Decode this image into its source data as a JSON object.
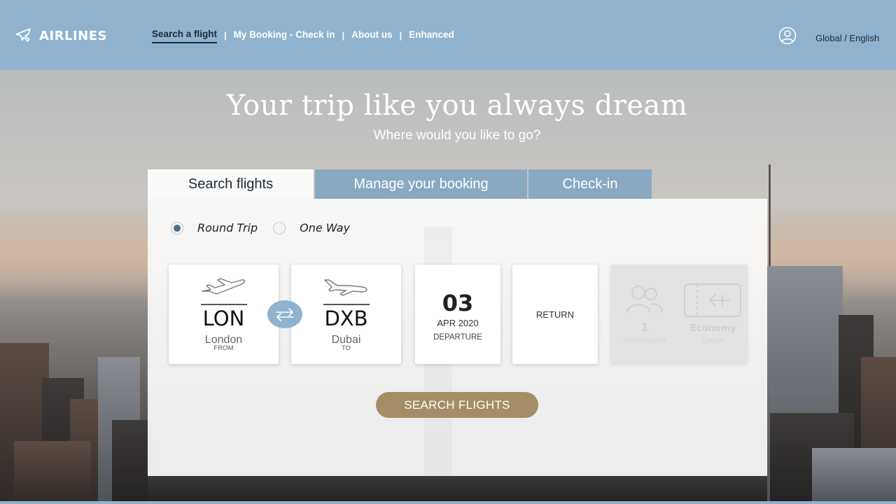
{
  "header": {
    "logo_text": "AIRLINES",
    "nav": [
      {
        "label": "Search a flight",
        "active": true
      },
      {
        "label": "My Booking - Check in",
        "active": false
      },
      {
        "label": "About us",
        "active": false
      },
      {
        "label": "Enhanced",
        "active": false
      }
    ],
    "separator": "|",
    "locale": "Global / English"
  },
  "hero": {
    "title": "Your trip like you always dream",
    "subtitle": "Where would you like to go?"
  },
  "tabs": [
    {
      "label": "Search flights",
      "active": true
    },
    {
      "label": "Manage your booking",
      "active": false
    },
    {
      "label": "Check-in",
      "active": false
    }
  ],
  "trip_type": {
    "options": [
      "Round Trip",
      "One Way"
    ],
    "selected": "Round Trip"
  },
  "from": {
    "code": "LON",
    "city": "London",
    "label": "FROM"
  },
  "to": {
    "code": "DXB",
    "city": "Dubai",
    "label": "TO"
  },
  "departure": {
    "day": "03",
    "month_year": "APR 2020",
    "label": "DEPARTURE"
  },
  "return": {
    "label": "RETURN"
  },
  "passengers": {
    "count": "1",
    "label": "PASSENGER"
  },
  "cabin": {
    "class": "Economy",
    "label": "CABIN"
  },
  "search_button": "SEARCH FLIGHTS",
  "colors": {
    "header_bg": "#8fb3cf",
    "tab_inactive": "#89a9c1",
    "button_gold": "#a38e66",
    "radio_checked": "#4f6f87"
  },
  "icons": [
    "plane-icon",
    "user-account-icon",
    "takeoff-icon",
    "landing-icon",
    "swap-arrows-icon",
    "passengers-icon",
    "boarding-pass-icon"
  ]
}
